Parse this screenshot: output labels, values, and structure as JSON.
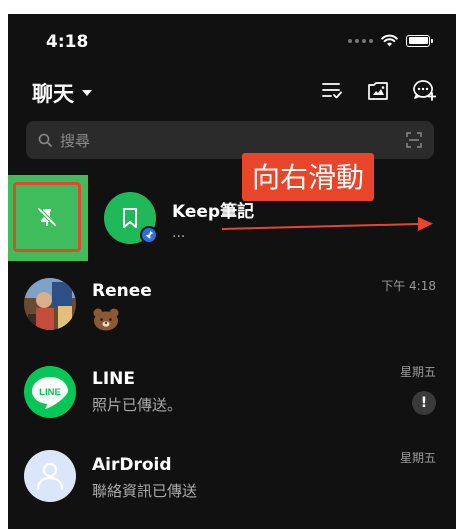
{
  "status_bar": {
    "time": "4:18"
  },
  "header": {
    "title": "聊天"
  },
  "search": {
    "placeholder": "搜尋"
  },
  "annotation": {
    "text": "向右滑動"
  },
  "chats": [
    {
      "name": "Keep筆記",
      "preview": "...",
      "time": "",
      "pinned": true
    },
    {
      "name": "Renee",
      "preview": "",
      "time": "下午 4:18"
    },
    {
      "name": "LINE",
      "preview": "照片已傳送。",
      "time": "星期五",
      "badge": "!"
    },
    {
      "name": "AirDroid",
      "preview": "聯絡資訊已傳送",
      "time": "星期五"
    }
  ],
  "colors": {
    "background": "#111111",
    "line_green": "#06c755",
    "swipe_action": "#3fbc5b",
    "annotation_red": "#e8452b",
    "pin_badge": "#2f6de1"
  }
}
